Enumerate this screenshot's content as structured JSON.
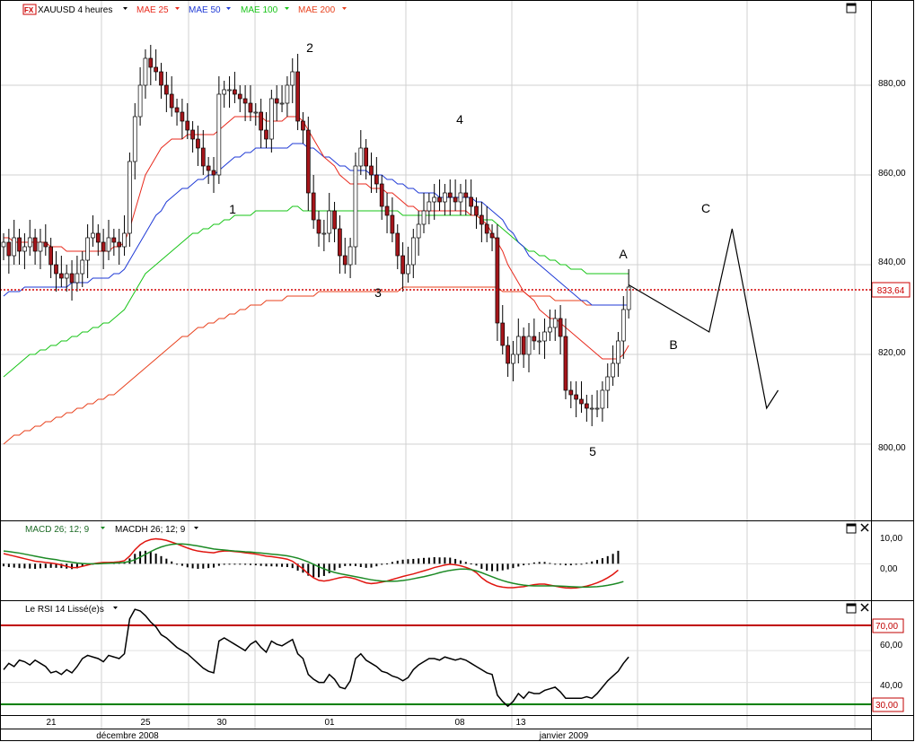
{
  "header": {
    "instrument": "XAUUSD 4 heures",
    "indicators": [
      {
        "label": "MAE 25",
        "color": "#e8291c"
      },
      {
        "label": "MAE 50",
        "color": "#1f3ad6"
      },
      {
        "label": "MAE 100",
        "color": "#17c417"
      },
      {
        "label": "MAE 200",
        "color": "#e8401c"
      }
    ]
  },
  "price_panel": {
    "y_ticks": [
      "880,00",
      "860,00",
      "840,00",
      "820,00",
      "800,00"
    ],
    "y_tick_values": [
      880,
      860,
      840,
      820,
      800
    ],
    "ylim": [
      783,
      898
    ],
    "current_price_label": "833,64",
    "current_price": 833.64,
    "wave_labels": [
      "1",
      "2",
      "3",
      "4",
      "5",
      "A",
      "B",
      "C"
    ]
  },
  "macd_panel": {
    "title": "MACD  26; 12; 9",
    "title2": "MACDH 26; 12; 9",
    "y_ticks": [
      "10,00",
      "0,00"
    ],
    "y_tick_values": [
      10,
      0
    ]
  },
  "rsi_panel": {
    "title": "Le RSI 14 Lissé(e)s",
    "y_ticks": [
      "60,00",
      "40,00"
    ],
    "level_labels": [
      "70,00",
      "30,00"
    ],
    "levels": [
      70,
      30
    ]
  },
  "x_axis": {
    "ticks": [
      "21",
      "25",
      "30",
      "01",
      "08",
      "13"
    ],
    "months": [
      "décembre 2008",
      "janvier 2009"
    ]
  },
  "colors": {
    "ma25": "#e8291c",
    "ma50": "#1f3ad6",
    "ma100": "#17c417",
    "ma200": "#e8401c",
    "up": "#ffffff",
    "down": "#a5151a",
    "macd": "#e0150f",
    "signal": "#1c8a25",
    "rsi_high": "#c00000",
    "rsi_low": "#008000"
  },
  "chart_data": {
    "type": "candlestick",
    "symbol": "XAUUSD",
    "timeframe": "4 heures",
    "closes": [
      845,
      842,
      846,
      843,
      844,
      846,
      843,
      845,
      844,
      840,
      838,
      837,
      838,
      836,
      838,
      841,
      846,
      847,
      845,
      843,
      846,
      845,
      844,
      847,
      863,
      873,
      880,
      886,
      884,
      883,
      880,
      878,
      875,
      874,
      872,
      870,
      868,
      866,
      862,
      861,
      860,
      878,
      879,
      879,
      878,
      877,
      876,
      874,
      874,
      870,
      868,
      877,
      876,
      876,
      880,
      883,
      872,
      870,
      856,
      850,
      847,
      847,
      852,
      848,
      842,
      840,
      844,
      862,
      866,
      862,
      860,
      858,
      853,
      851,
      847,
      842,
      838,
      840,
      846,
      849,
      852,
      854,
      855,
      854,
      856,
      855,
      854,
      856,
      855,
      853,
      851,
      849,
      847,
      846,
      827,
      822,
      818,
      820,
      824,
      820,
      824,
      823,
      823,
      825,
      826,
      828,
      824,
      812,
      811,
      810,
      809,
      808,
      808,
      808,
      812,
      815,
      818,
      823,
      830,
      835
    ],
    "ma25": [
      846,
      846,
      845,
      845,
      845,
      845,
      845,
      845,
      845,
      844,
      844,
      844,
      843,
      843,
      843,
      843,
      843,
      843,
      843,
      843,
      843,
      844,
      844,
      845,
      848,
      852,
      856,
      860,
      862,
      864,
      866,
      867,
      868,
      868,
      868,
      869,
      869,
      869,
      869,
      869,
      869,
      870,
      871,
      872,
      873,
      873,
      873,
      873,
      873,
      873,
      872,
      872,
      872,
      872,
      873,
      873,
      873,
      872,
      870,
      868,
      866,
      864,
      863,
      862,
      860,
      859,
      858,
      858,
      858,
      858,
      857,
      857,
      857,
      856,
      856,
      855,
      854,
      853,
      853,
      852,
      852,
      852,
      852,
      852,
      852,
      852,
      852,
      852,
      852,
      851,
      851,
      850,
      849,
      847,
      845,
      843,
      840,
      838,
      836,
      834,
      833,
      832,
      830,
      829,
      828,
      828,
      827,
      826,
      825,
      824,
      823,
      822,
      821,
      820,
      819,
      819,
      819,
      819,
      820,
      822
    ],
    "ma50": [
      833,
      834,
      834,
      834,
      835,
      835,
      835,
      835,
      835,
      835,
      835,
      835,
      835,
      836,
      836,
      836,
      836,
      837,
      837,
      837,
      837,
      838,
      838,
      839,
      841,
      843,
      845,
      847,
      849,
      851,
      852,
      854,
      855,
      856,
      857,
      857,
      858,
      859,
      859,
      860,
      860,
      861,
      862,
      863,
      864,
      864,
      865,
      865,
      866,
      866,
      866,
      866,
      866,
      866,
      866,
      867,
      867,
      867,
      866,
      866,
      865,
      864,
      864,
      863,
      862,
      862,
      861,
      861,
      861,
      861,
      860,
      860,
      860,
      859,
      859,
      858,
      858,
      857,
      857,
      856,
      856,
      856,
      856,
      855,
      855,
      855,
      855,
      855,
      855,
      855,
      854,
      854,
      853,
      852,
      851,
      850,
      848,
      847,
      845,
      844,
      842,
      841,
      840,
      839,
      838,
      837,
      836,
      835,
      834,
      833,
      832,
      832,
      831,
      831,
      831,
      831,
      831,
      831,
      831,
      831
    ],
    "ma100": [
      815,
      816,
      817,
      818,
      819,
      820,
      820,
      821,
      821,
      822,
      822,
      823,
      823,
      824,
      824,
      825,
      825,
      826,
      826,
      827,
      827,
      828,
      829,
      830,
      832,
      834,
      836,
      838,
      839,
      840,
      841,
      842,
      843,
      844,
      845,
      846,
      847,
      847,
      848,
      848,
      849,
      849,
      850,
      850,
      851,
      851,
      851,
      851,
      852,
      852,
      852,
      852,
      852,
      852,
      852,
      853,
      853,
      852,
      852,
      852,
      852,
      852,
      852,
      852,
      852,
      852,
      852,
      852,
      852,
      852,
      852,
      852,
      852,
      852,
      852,
      852,
      851,
      851,
      851,
      851,
      851,
      851,
      851,
      851,
      851,
      851,
      851,
      851,
      851,
      851,
      851,
      850,
      850,
      850,
      849,
      848,
      847,
      846,
      845,
      844,
      843,
      843,
      842,
      842,
      841,
      841,
      840,
      840,
      839,
      839,
      839,
      838,
      838,
      838,
      838,
      838,
      838,
      838,
      838,
      838
    ],
    "ma200": [
      800,
      801,
      802,
      802,
      803,
      803,
      804,
      804,
      805,
      805,
      806,
      806,
      807,
      807,
      808,
      808,
      809,
      809,
      810,
      810,
      811,
      811,
      812,
      813,
      814,
      815,
      816,
      817,
      818,
      819,
      820,
      821,
      822,
      823,
      824,
      824,
      825,
      826,
      826,
      827,
      827,
      828,
      828,
      829,
      829,
      830,
      830,
      831,
      831,
      831,
      832,
      832,
      832,
      832,
      833,
      833,
      833,
      833,
      833,
      833,
      834,
      834,
      834,
      834,
      834,
      834,
      834,
      834,
      834,
      834,
      834,
      834,
      834,
      834,
      834,
      834,
      835,
      835,
      835,
      835,
      835,
      835,
      835,
      835,
      835,
      835,
      835,
      835,
      835,
      835,
      835,
      835,
      835,
      835,
      835,
      834,
      834,
      834,
      834,
      834,
      833,
      833,
      833,
      833,
      833,
      832,
      832,
      832,
      832,
      832,
      832,
      831,
      831,
      831,
      831,
      831,
      831,
      831,
      831,
      831
    ],
    "rsi": [
      48,
      52,
      50,
      54,
      53,
      51,
      54,
      52,
      50,
      46,
      47,
      45,
      48,
      46,
      50,
      55,
      57,
      56,
      55,
      53,
      57,
      56,
      55,
      58,
      80,
      86,
      85,
      82,
      78,
      75,
      70,
      68,
      65,
      62,
      60,
      58,
      55,
      52,
      49,
      47,
      46,
      66,
      68,
      66,
      64,
      62,
      60,
      64,
      66,
      62,
      59,
      66,
      64,
      63,
      65,
      67,
      58,
      55,
      45,
      42,
      40,
      40,
      45,
      42,
      37,
      36,
      41,
      55,
      58,
      54,
      52,
      50,
      47,
      46,
      44,
      43,
      41,
      43,
      48,
      51,
      53,
      55,
      55,
      54,
      56,
      55,
      54,
      55,
      54,
      52,
      50,
      48,
      46,
      45,
      32,
      28,
      25,
      28,
      33,
      30,
      34,
      33,
      33,
      35,
      36,
      37,
      34,
      30,
      30,
      30,
      30,
      31,
      30,
      33,
      37,
      41,
      44,
      47,
      52,
      56
    ],
    "macd": [
      4,
      3.5,
      3,
      2.5,
      2,
      1.5,
      1,
      0.8,
      0.5,
      0.3,
      0,
      -0.5,
      -1,
      -1.5,
      -1.5,
      -1,
      -0.5,
      0,
      0.3,
      0.5,
      0.5,
      0.6,
      0.8,
      1.2,
      3,
      5.5,
      7.5,
      8.8,
      9.5,
      9.8,
      9.6,
      9.2,
      8.5,
      7.8,
      7,
      6.2,
      5.5,
      5,
      4.7,
      4.5,
      4.3,
      4.8,
      5,
      5,
      4.8,
      4.6,
      4.3,
      4.1,
      3.8,
      3.4,
      3,
      2.8,
      2.5,
      2.2,
      1.8,
      1,
      -0.5,
      -2,
      -4,
      -5.5,
      -6.5,
      -6.8,
      -6.5,
      -6,
      -5.5,
      -5.2,
      -5.5,
      -6,
      -6.8,
      -7.5,
      -7.8,
      -7.6,
      -7.2,
      -6.8,
      -6.2,
      -5.6,
      -5,
      -4.5,
      -4,
      -3.4,
      -2.8,
      -2.2,
      -1.5,
      -1,
      -0.5,
      -0.2,
      -0.4,
      -0.8,
      -1.4,
      -2.2,
      -3.5,
      -5.5,
      -7,
      -8,
      -8.8,
      -9.2,
      -9.4,
      -9.4,
      -9.2,
      -9,
      -8.6,
      -8.2,
      -8,
      -8,
      -8.4,
      -8.8,
      -9.2,
      -9.5,
      -9.6,
      -9.5,
      -9.2,
      -8.8,
      -8.2,
      -7.5,
      -6.6,
      -5.5,
      -4.2,
      -2.5
    ],
    "signal": [
      5,
      4.8,
      4.5,
      4.2,
      3.8,
      3.4,
      3,
      2.6,
      2.2,
      1.9,
      1.6,
      1.2,
      0.9,
      0.6,
      0.3,
      0.1,
      0,
      0,
      0,
      0.1,
      0.2,
      0.3,
      0.4,
      0.5,
      0.9,
      1.6,
      2.6,
      3.7,
      4.8,
      5.8,
      6.6,
      7.2,
      7.6,
      7.8,
      7.8,
      7.6,
      7.3,
      7,
      6.6,
      6.2,
      5.8,
      5.6,
      5.4,
      5.2,
      5,
      4.9,
      4.7,
      4.6,
      4.4,
      4.2,
      4,
      3.8,
      3.6,
      3.4,
      3.1,
      2.7,
      2.2,
      1.5,
      0.7,
      -0.2,
      -1.2,
      -2,
      -2.8,
      -3.4,
      -3.9,
      -4.3,
      -4.7,
      -5.1,
      -5.5,
      -5.9,
      -6.3,
      -6.6,
      -6.8,
      -6.9,
      -6.9,
      -6.8,
      -6.6,
      -6.3,
      -5.9,
      -5.5,
      -5.1,
      -4.6,
      -4.1,
      -3.5,
      -3,
      -2.6,
      -2.3,
      -2.1,
      -2.1,
      -2.3,
      -2.8,
      -3.5,
      -4.3,
      -5.1,
      -5.9,
      -6.6,
      -7.2,
      -7.7,
      -8.1,
      -8.4,
      -8.6,
      -8.7,
      -8.7,
      -8.7,
      -8.7,
      -8.7,
      -8.8,
      -8.9,
      -9,
      -9.1,
      -9.2,
      -9.2,
      -9.1,
      -9,
      -8.8,
      -8.5,
      -8.1,
      -7.6,
      -7
    ],
    "projection": [
      [
        835.5,
        0
      ],
      [
        825,
        14
      ],
      [
        848,
        18
      ],
      [
        808,
        24
      ],
      [
        812,
        26
      ]
    ],
    "ylim_price": [
      783,
      898
    ],
    "ylim_macd": [
      -14,
      16
    ],
    "ylim_rsi": [
      20,
      90
    ]
  }
}
